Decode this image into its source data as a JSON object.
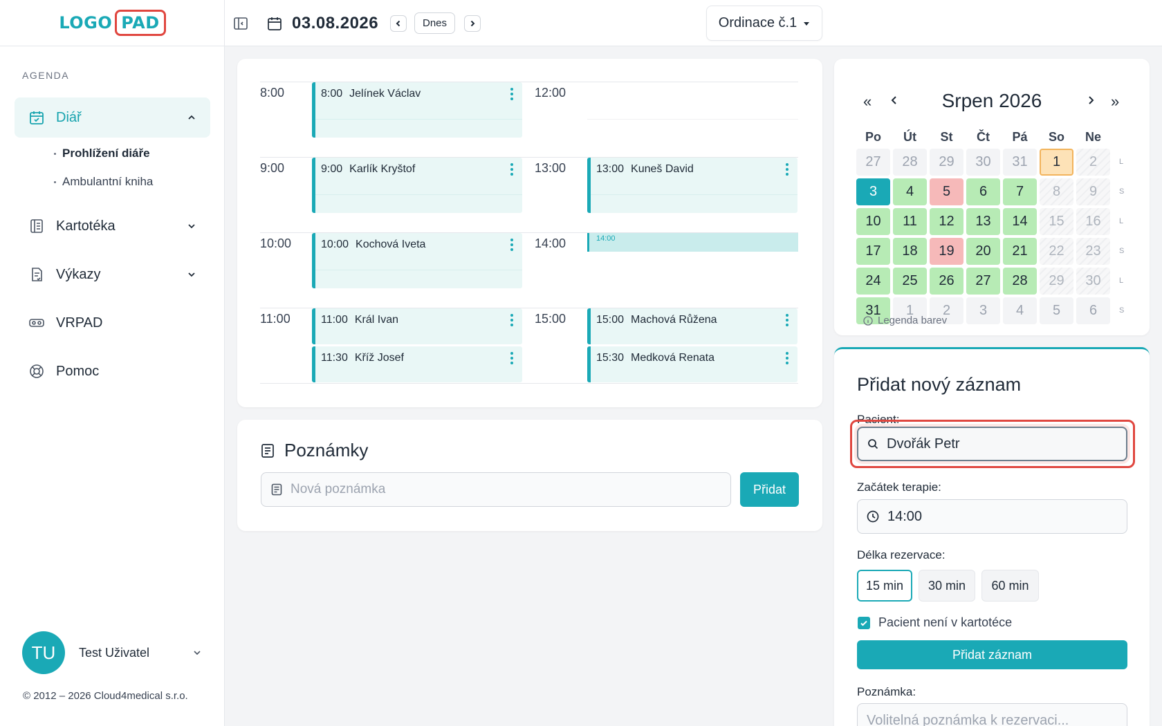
{
  "logo": {
    "part1": "LOGO",
    "part2": "PAD"
  },
  "sidebar": {
    "section_label": "AGENDA",
    "items": [
      {
        "label": "Diář",
        "icon": "calendar-check-icon"
      },
      {
        "label": "Kartotéka",
        "icon": "address-book-icon"
      },
      {
        "label": "Výkazy",
        "icon": "report-icon"
      },
      {
        "label": "VRPAD",
        "icon": "vr-headset-icon"
      },
      {
        "label": "Pomoc",
        "icon": "lifebuoy-icon"
      }
    ],
    "subitems": [
      {
        "label": "Prohlížení diáře"
      },
      {
        "label": "Ambulantní kniha"
      }
    ],
    "user": {
      "initials": "TU",
      "name": "Test Uživatel"
    },
    "copyright": "© 2012 – 2026 Cloud4medical s.r.o."
  },
  "topbar": {
    "date": "03.08.2026",
    "today_label": "Dnes",
    "office": "Ordinace č.1"
  },
  "schedule": {
    "left": [
      {
        "time": "8:00",
        "appts": [
          {
            "time": "8:00",
            "name": "Jelínek Václav"
          }
        ]
      },
      {
        "time": "9:00",
        "appts": [
          {
            "time": "9:00",
            "name": "Karlík Kryštof"
          }
        ]
      },
      {
        "time": "10:00",
        "appts": [
          {
            "time": "10:00",
            "name": "Kochová Iveta"
          }
        ]
      },
      {
        "time": "11:00",
        "appts": [
          {
            "time": "11:00",
            "name": "Král Ivan"
          },
          {
            "time": "11:30",
            "name": "Kříž Josef"
          }
        ]
      }
    ],
    "right": [
      {
        "time": "12:00",
        "appts": []
      },
      {
        "time": "13:00",
        "appts": [
          {
            "time": "13:00",
            "name": "Kuneš David"
          }
        ]
      },
      {
        "time": "14:00",
        "free": "14:00"
      },
      {
        "time": "15:00",
        "appts": [
          {
            "time": "15:00",
            "name": "Machová Růžena"
          },
          {
            "time": "15:30",
            "name": "Medková Renata"
          }
        ]
      }
    ]
  },
  "notes": {
    "title": "Poznámky",
    "placeholder": "Nová poznámka",
    "add_label": "Přidat"
  },
  "calendar": {
    "month": "Srpen 2026",
    "nav": {
      "prev_year": "«",
      "prev": "‹",
      "next": "›",
      "next_year": "»"
    },
    "weekdays": [
      "Po",
      "Út",
      "St",
      "Čt",
      "Pá",
      "So",
      "Ne"
    ],
    "weeks": [
      {
        "mark": "L",
        "days": [
          {
            "d": "27",
            "s": "other"
          },
          {
            "d": "28",
            "s": "other"
          },
          {
            "d": "29",
            "s": "other"
          },
          {
            "d": "30",
            "s": "other"
          },
          {
            "d": "31",
            "s": "other"
          },
          {
            "d": "1",
            "s": "selected"
          },
          {
            "d": "2",
            "s": "weekend"
          }
        ]
      },
      {
        "mark": "S",
        "days": [
          {
            "d": "3",
            "s": "today"
          },
          {
            "d": "4",
            "s": "green"
          },
          {
            "d": "5",
            "s": "red"
          },
          {
            "d": "6",
            "s": "green"
          },
          {
            "d": "7",
            "s": "green"
          },
          {
            "d": "8",
            "s": "weekend"
          },
          {
            "d": "9",
            "s": "weekend"
          }
        ]
      },
      {
        "mark": "L",
        "days": [
          {
            "d": "10",
            "s": "green"
          },
          {
            "d": "11",
            "s": "green"
          },
          {
            "d": "12",
            "s": "green"
          },
          {
            "d": "13",
            "s": "green"
          },
          {
            "d": "14",
            "s": "green"
          },
          {
            "d": "15",
            "s": "weekend"
          },
          {
            "d": "16",
            "s": "weekend"
          }
        ]
      },
      {
        "mark": "S",
        "days": [
          {
            "d": "17",
            "s": "green"
          },
          {
            "d": "18",
            "s": "green"
          },
          {
            "d": "19",
            "s": "red"
          },
          {
            "d": "20",
            "s": "green"
          },
          {
            "d": "21",
            "s": "green"
          },
          {
            "d": "22",
            "s": "weekend"
          },
          {
            "d": "23",
            "s": "weekend"
          }
        ]
      },
      {
        "mark": "L",
        "days": [
          {
            "d": "24",
            "s": "green"
          },
          {
            "d": "25",
            "s": "green"
          },
          {
            "d": "26",
            "s": "green"
          },
          {
            "d": "27",
            "s": "green"
          },
          {
            "d": "28",
            "s": "green"
          },
          {
            "d": "29",
            "s": "weekend"
          },
          {
            "d": "30",
            "s": "weekend"
          }
        ]
      },
      {
        "mark": "S",
        "days": [
          {
            "d": "31",
            "s": "green"
          },
          {
            "d": "1",
            "s": "other"
          },
          {
            "d": "2",
            "s": "other"
          },
          {
            "d": "3",
            "s": "other"
          },
          {
            "d": "4",
            "s": "other"
          },
          {
            "d": "5",
            "s": "other"
          },
          {
            "d": "6",
            "s": "other"
          }
        ]
      }
    ],
    "legend": "Legenda barev"
  },
  "form": {
    "title": "Přidat nový záznam",
    "patient_label": "Pacient:",
    "patient_value": "Dvořák Petr",
    "start_label": "Začátek terapie:",
    "start_value": "14:00",
    "duration_label": "Délka rezervace:",
    "durations": [
      "15 min",
      "30 min",
      "60 min"
    ],
    "selected_duration": "15 min",
    "not_in_registry": "Pacient není v kartotéce",
    "submit_label": "Přidat záznam",
    "note_label": "Poznámka:",
    "note_placeholder": "Volitelná poznámka k rezervaci..."
  },
  "colors": {
    "accent": "#1aa9b6",
    "available_day": "#b7ebb5",
    "full_day": "#f6b9b9",
    "selected_day": "#fde2b7",
    "highlight": "#e0463f"
  }
}
